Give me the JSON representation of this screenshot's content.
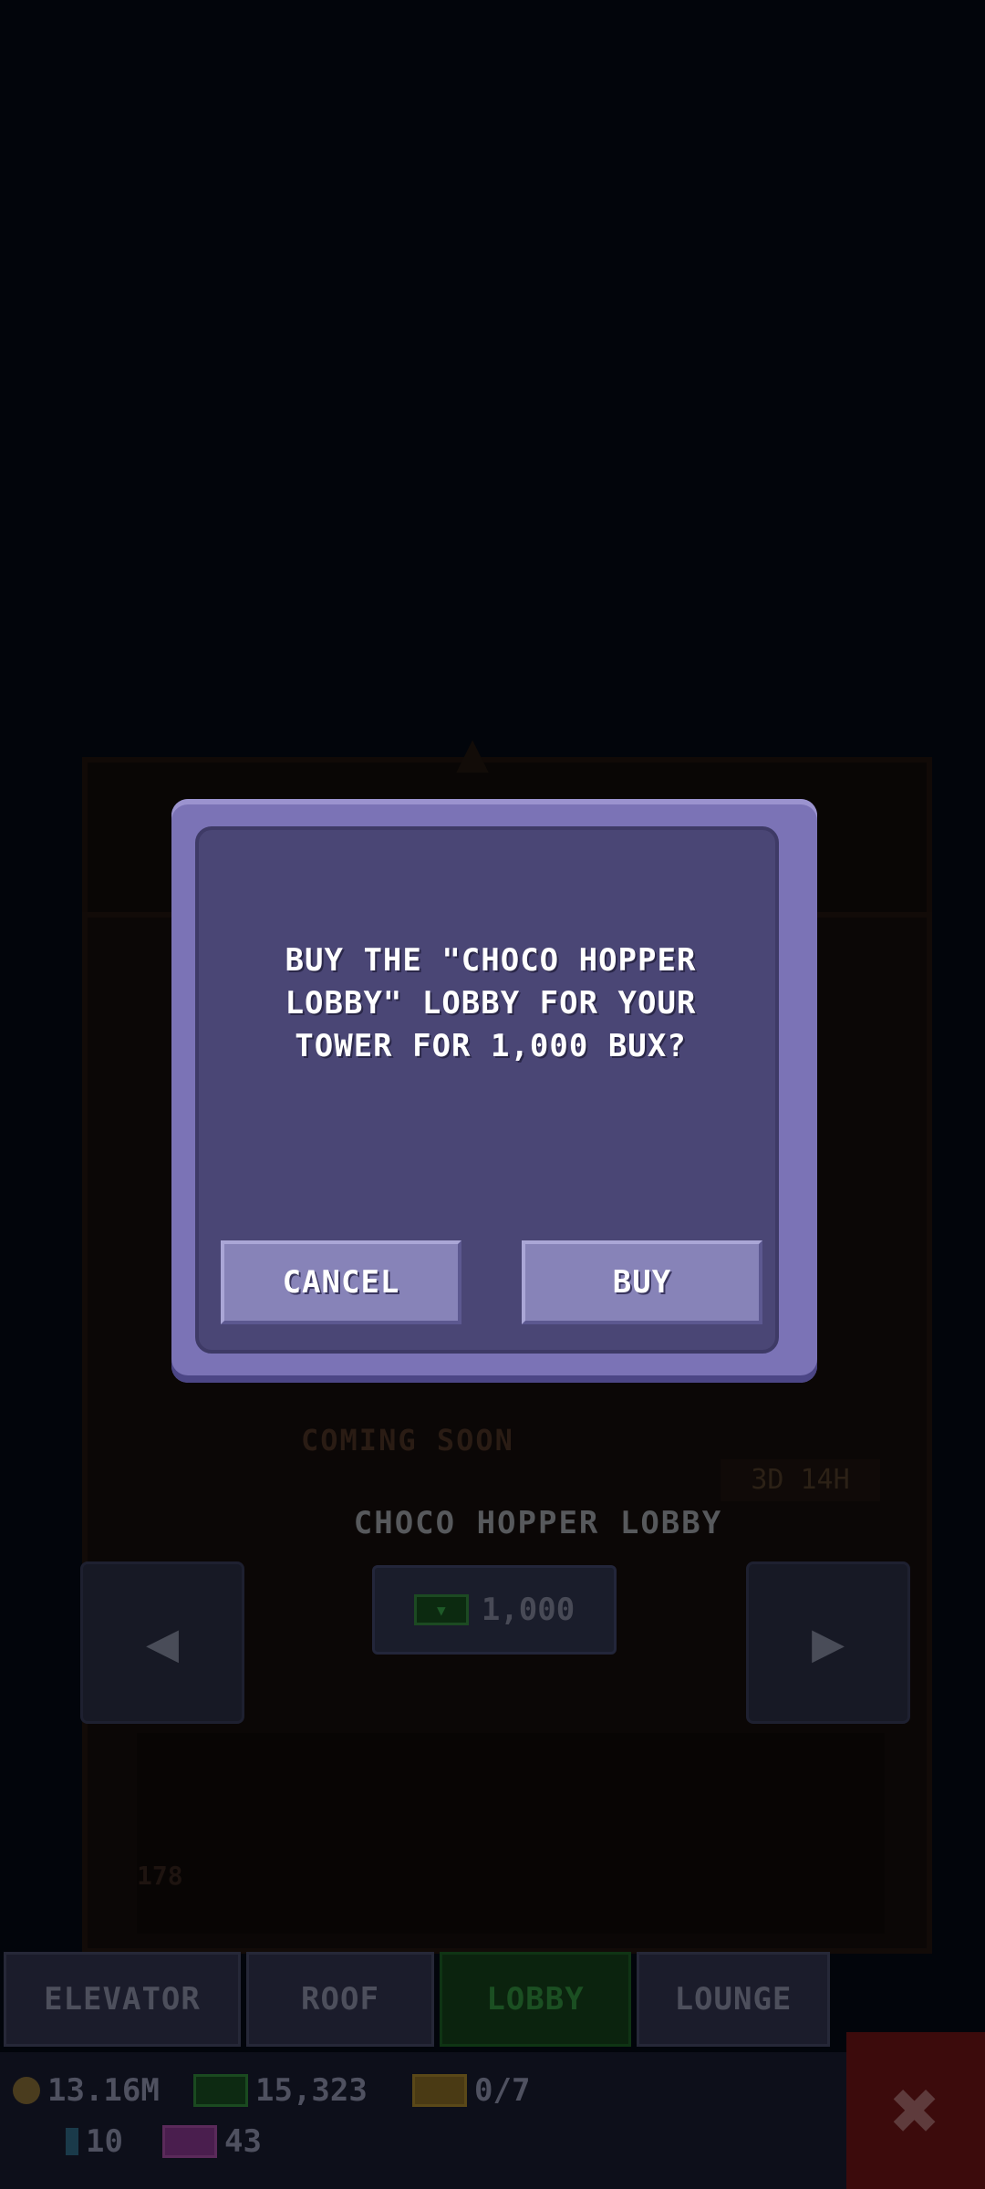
{
  "dialog": {
    "message": "BUY THE \"CHOCO HOPPER LOBBY\" LOBBY FOR YOUR TOWER FOR 1,000 BUX?",
    "cancel_label": "CANCEL",
    "buy_label": "BUY"
  },
  "background": {
    "coming_soon": "COMING SOON",
    "timer": "3D 14H",
    "skin_name": "CHOCO HOPPER LOBBY",
    "price": "1,000",
    "floor_number": "178"
  },
  "tabs": [
    {
      "label": "ELEVATOR",
      "active": false
    },
    {
      "label": "ROOF",
      "active": false
    },
    {
      "label": "LOBBY",
      "active": true
    },
    {
      "label": "LOUNGE",
      "active": false
    }
  ],
  "status": {
    "coins": "13.16M",
    "bux": "15,323",
    "tickets": "0/7",
    "gems": "10",
    "tv": "43"
  },
  "colors": {
    "modal_frame": "#7b73b6",
    "modal_panel": "#4a4675",
    "button": "#8783b8",
    "active_tab": "#0b230e",
    "close_button": "#3c0b0c"
  }
}
